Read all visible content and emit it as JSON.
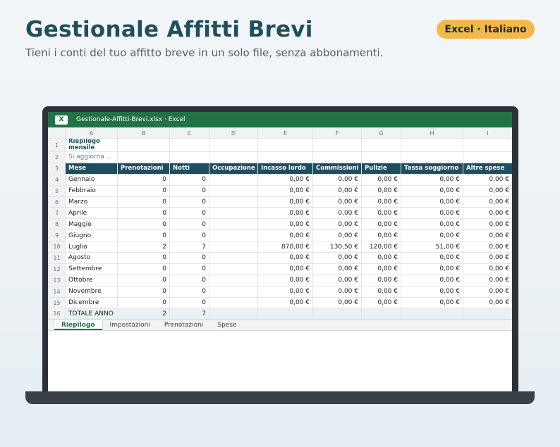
{
  "header": {
    "title": "Gestionale Affitti Brevi",
    "subtitle": "Tieni i conti del tuo affitto breve in un solo file, senza abbonamenti.",
    "badge": "Excel · Italiano"
  },
  "window": {
    "app_icon_letter": "X",
    "title": "Gestionale-Affitti-Brevi.xlsx · Excel"
  },
  "sheet": {
    "columns": [
      "A",
      "B",
      "C",
      "D",
      "E",
      "F",
      "G",
      "H",
      "I"
    ],
    "row1_title": "Riepilogo mensile",
    "row2_note": "Si aggiorna ...",
    "headers": [
      "Mese",
      "Prenotazioni",
      "Notti",
      "Occupazione",
      "Incasso lordo",
      "Commissioni",
      "Pulizie",
      "Tassa soggiorno",
      "Altre spese"
    ],
    "months": [
      {
        "mese": "Gennaio",
        "pren": "0",
        "notti": "0",
        "occ": "",
        "incasso": "0,00 €",
        "comm": "0,00 €",
        "pul": "0,00 €",
        "tassa": "0,00 €",
        "altre": "0,00 €"
      },
      {
        "mese": "Febbraio",
        "pren": "0",
        "notti": "0",
        "occ": "",
        "incasso": "0,00 €",
        "comm": "0,00 €",
        "pul": "0,00 €",
        "tassa": "0,00 €",
        "altre": "0,00 €"
      },
      {
        "mese": "Marzo",
        "pren": "0",
        "notti": "0",
        "occ": "",
        "incasso": "0,00 €",
        "comm": "0,00 €",
        "pul": "0,00 €",
        "tassa": "0,00 €",
        "altre": "0,00 €"
      },
      {
        "mese": "Aprile",
        "pren": "0",
        "notti": "0",
        "occ": "",
        "incasso": "0,00 €",
        "comm": "0,00 €",
        "pul": "0,00 €",
        "tassa": "0,00 €",
        "altre": "0,00 €"
      },
      {
        "mese": "Maggio",
        "pren": "0",
        "notti": "0",
        "occ": "",
        "incasso": "0,00 €",
        "comm": "0,00 €",
        "pul": "0,00 €",
        "tassa": "0,00 €",
        "altre": "0,00 €"
      },
      {
        "mese": "Giugno",
        "pren": "0",
        "notti": "0",
        "occ": "",
        "incasso": "0,00 €",
        "comm": "0,00 €",
        "pul": "0,00 €",
        "tassa": "0,00 €",
        "altre": "0,00 €"
      },
      {
        "mese": "Luglio",
        "pren": "2",
        "notti": "7",
        "occ": "",
        "incasso": "870,00 €",
        "comm": "130,50 €",
        "pul": "120,00 €",
        "tassa": "51,00 €",
        "altre": "0,00 €"
      },
      {
        "mese": "Agosto",
        "pren": "0",
        "notti": "0",
        "occ": "",
        "incasso": "0,00 €",
        "comm": "0,00 €",
        "pul": "0,00 €",
        "tassa": "0,00 €",
        "altre": "0,00 €"
      },
      {
        "mese": "Settembre",
        "pren": "0",
        "notti": "0",
        "occ": "",
        "incasso": "0,00 €",
        "comm": "0,00 €",
        "pul": "0,00 €",
        "tassa": "0,00 €",
        "altre": "0,00 €"
      },
      {
        "mese": "Ottobre",
        "pren": "0",
        "notti": "0",
        "occ": "",
        "incasso": "0,00 €",
        "comm": "0,00 €",
        "pul": "0,00 €",
        "tassa": "0,00 €",
        "altre": "0,00 €"
      },
      {
        "mese": "Novembre",
        "pren": "0",
        "notti": "0",
        "occ": "",
        "incasso": "0,00 €",
        "comm": "0,00 €",
        "pul": "0,00 €",
        "tassa": "0,00 €",
        "altre": "0,00 €"
      },
      {
        "mese": "Dicembre",
        "pren": "0",
        "notti": "0",
        "occ": "",
        "incasso": "0,00 €",
        "comm": "0,00 €",
        "pul": "0,00 €",
        "tassa": "0,00 €",
        "altre": "0,00 €"
      }
    ],
    "total": {
      "label": "TOTALE ANNO",
      "pren": "2",
      "notti": "7"
    }
  },
  "tabs": [
    {
      "label": "Riepilogo",
      "active": true
    },
    {
      "label": "Impostazioni",
      "active": false
    },
    {
      "label": "Prenotazioni",
      "active": false
    },
    {
      "label": "Spese",
      "active": false
    }
  ],
  "colors": {
    "excel_green": "#217346",
    "header_teal": "#1f4e5f",
    "badge": "#f2b94a"
  }
}
